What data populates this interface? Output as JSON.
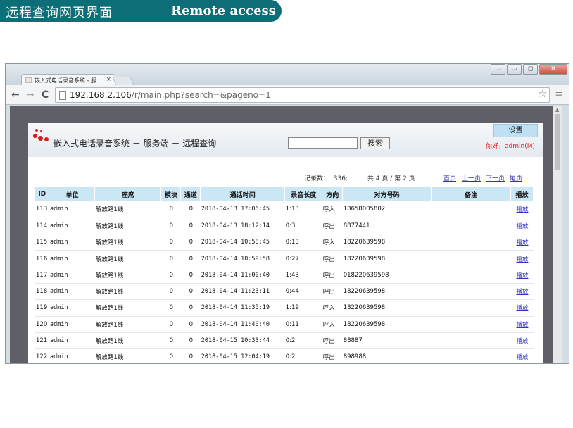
{
  "banner": {
    "title_cn": "远程查询网页界面",
    "title_en": "Remote access"
  },
  "browser": {
    "tab_title": "嵌入式电话录音系统 - 服",
    "tab_close": "×",
    "url_host": "192.168.2.106",
    "url_path": "/r/main.php?search=&pageno=1",
    "nav_back": "←",
    "nav_forward": "→",
    "nav_reload": "C",
    "star": "☆",
    "menu": "≡",
    "win_min": "▭",
    "win_restore": "▭",
    "win_max": "◻",
    "win_close": "✕"
  },
  "header": {
    "system_title": "嵌入式电话录音系统 － 服务端 － 远程查询",
    "search_button": "搜索",
    "settings_button": "设置",
    "greeting": "你好，admin(M)"
  },
  "pager": {
    "records_label": "记录数：",
    "records_count": "336;",
    "pages_text": "共 4 页 / 第 2 页",
    "first": "首页",
    "prev": "上一页",
    "next": "下一页",
    "last": "尾页"
  },
  "table": {
    "columns": [
      "ID",
      "单位",
      "座席",
      "模块",
      "通道",
      "通话时间",
      "录音长度",
      "方向",
      "对方号码",
      "备注",
      "播放"
    ],
    "rows": [
      [
        "113",
        "admin",
        "解放路1线",
        "0",
        "0",
        "2018-04-13 17:06:45",
        "1:13",
        "呼入",
        "18658005802",
        "",
        "播放"
      ],
      [
        "114",
        "admin",
        "解放路1线",
        "0",
        "0",
        "2018-04-13 18:12:14",
        "0:3",
        "呼出",
        "8877441",
        "",
        "播放"
      ],
      [
        "115",
        "admin",
        "解放路1线",
        "0",
        "0",
        "2018-04-14 10:58:45",
        "0:13",
        "呼入",
        "18220639598",
        "",
        "播放"
      ],
      [
        "116",
        "admin",
        "解放路1线",
        "0",
        "0",
        "2018-04-14 10:59:58",
        "0:27",
        "呼出",
        "18220639598",
        "",
        "播放"
      ],
      [
        "117",
        "admin",
        "解放路1线",
        "0",
        "0",
        "2018-04-14 11:00:40",
        "1:43",
        "呼出",
        "018220639598",
        "",
        "播放"
      ],
      [
        "118",
        "admin",
        "解放路1线",
        "0",
        "0",
        "2018-04-14 11:23:11",
        "0:44",
        "呼出",
        "18220639598",
        "",
        "播放"
      ],
      [
        "119",
        "admin",
        "解放路1线",
        "0",
        "0",
        "2018-04-14 11:35:19",
        "1:19",
        "呼入",
        "18220639598",
        "",
        "播放"
      ],
      [
        "120",
        "admin",
        "解放路1线",
        "0",
        "0",
        "2018-04-14 11:40:40",
        "0:11",
        "呼入",
        "18220639598",
        "",
        "播放"
      ],
      [
        "121",
        "admin",
        "解放路1线",
        "0",
        "0",
        "2018-04-15 10:33:44",
        "0:2",
        "呼出",
        "88887",
        "",
        "播放"
      ],
      [
        "122",
        "admin",
        "解放路1线",
        "0",
        "0",
        "2018-04-15 12:04:19",
        "0:2",
        "呼出",
        "898988",
        "",
        "播放"
      ]
    ]
  },
  "colors": {
    "banner": "#0e6e78",
    "header_bg": "#cbe7f6",
    "link": "#3333cc",
    "greeting": "#e02020",
    "logo": "#e01a1a"
  },
  "icons": {
    "logo": "red-dots-logo-icon",
    "page": "page-icon",
    "star": "star-icon",
    "menu": "hamburger-menu-icon"
  }
}
